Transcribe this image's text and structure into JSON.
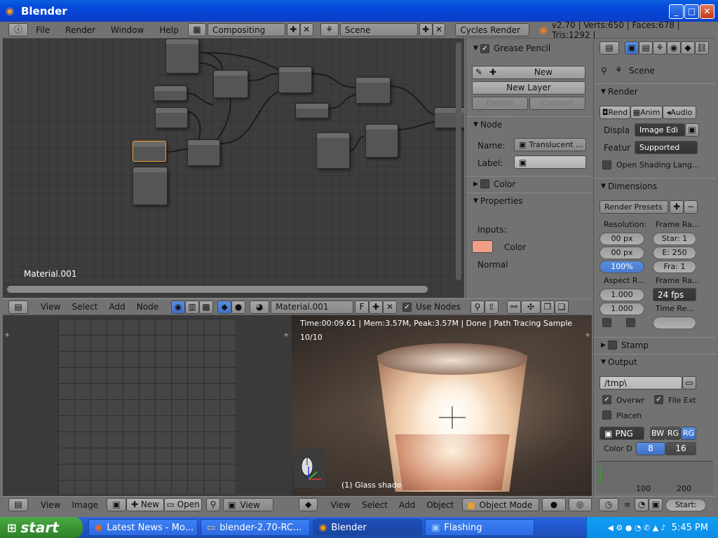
{
  "window": {
    "title": "Blender"
  },
  "menu": {
    "items": [
      "File",
      "Render",
      "Window",
      "Help"
    ],
    "layout": "Compositing",
    "scene": "Scene",
    "engine": "Cycles Render",
    "stats": "v2.70 | Verts:650 | Faces:678 | Tris:1292 |"
  },
  "node_editor": {
    "material_label": "Material.001",
    "header": {
      "items": [
        "View",
        "Select",
        "Add",
        "Node"
      ],
      "material": "Material.001",
      "fake_user": "F",
      "use_nodes_label": "Use Nodes",
      "use_nodes": true
    }
  },
  "npanel": {
    "grease_pencil": {
      "title": "Grease Pencil",
      "enabled": true,
      "new_label": "New",
      "new_layer_label": "New Layer",
      "delete_frame_label": "Delete Frame",
      "convert_label": "Convert"
    },
    "node": {
      "title": "Node",
      "name_label": "Name:",
      "name_value": "Translucent ...",
      "label_label": "Label:",
      "label_value": ""
    },
    "color": {
      "title": "Color"
    },
    "properties": {
      "title": "Properties",
      "inputs_label": "Inputs:",
      "color_label": "Color",
      "normal_label": "Normal",
      "swatch": "#f0a088"
    }
  },
  "viewport": {
    "status": "Time:00:09.61 | Mem:3.57M, Peak:3.57M | Done | Path Tracing Sample 10/10",
    "object_label": "(1) Glass shade",
    "header": {
      "items": [
        "View",
        "Select",
        "Add",
        "Object"
      ],
      "mode": "Object Mode"
    }
  },
  "image_editor": {
    "header": {
      "items": [
        "View",
        "Image"
      ],
      "new_label": "New",
      "open_label": "Open",
      "view_label": "View"
    }
  },
  "properties": {
    "context": "Scene",
    "render": {
      "title": "Render",
      "tabs": [
        "Rend",
        "Anim",
        "Audio"
      ],
      "display_label": "Displa",
      "display_value": "Image Edi",
      "feature_label": "Featur",
      "feature_value": "Supported",
      "osl_label": "Open Shading Lang..."
    },
    "dimensions": {
      "title": "Dimensions",
      "presets": "Render Presets",
      "resolution_label": "Resolution:",
      "frame_range_label": "Frame Ra...",
      "res_x": "00 px",
      "res_y": "00 px",
      "res_pct": "100%",
      "start": "Star: 1",
      "end": "E: 250",
      "frame": "Fra: 1",
      "aspect_label": "Aspect R...",
      "frame_rate_label": "Frame Ra...",
      "aspect_x": "1.000",
      "aspect_y": "1.000",
      "fps": "24 fps",
      "time_remap_label": "Time Re..."
    },
    "stamp": {
      "title": "Stamp"
    },
    "output": {
      "title": "Output",
      "path": "/tmp\\",
      "overwrite_label": "Overwr",
      "file_ext_label": "File Ext",
      "placeholders_label": "Placeh",
      "format": "PNG",
      "bw": "BW",
      "rgb": "RG",
      "rgba": "RG",
      "color_depth_label": "Color D",
      "depth_8": "8",
      "depth_16": "16"
    },
    "timeline": {
      "tick_100": "100",
      "tick_200": "200",
      "start_label": "Start:"
    }
  },
  "taskbar": {
    "start_label": "start",
    "buttons": [
      "Latest News - Mo...",
      "blender-2.70-RC...",
      "Blender",
      "Flashing"
    ],
    "clock": "5:45 PM"
  }
}
